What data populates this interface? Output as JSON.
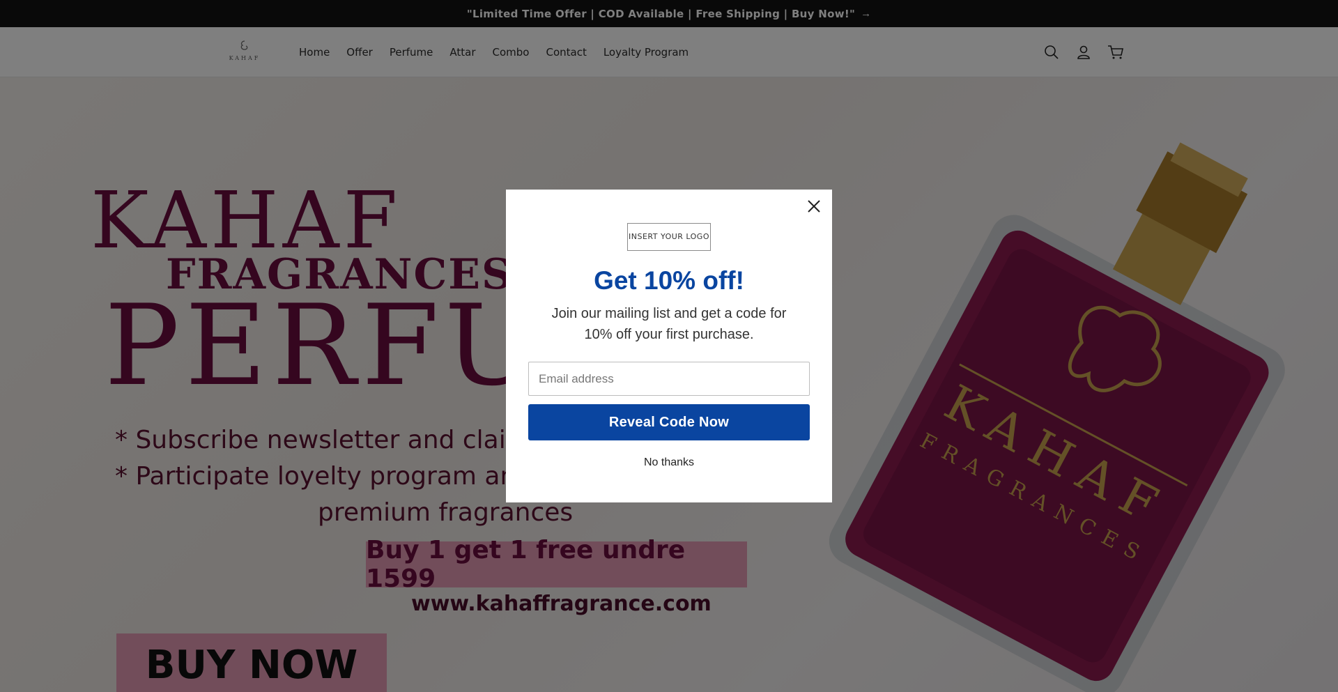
{
  "announcement": {
    "text": "\"Limited Time Offer | COD Available | Free Shipping | Buy Now!\"",
    "arrow": "→"
  },
  "header": {
    "logo_text": "KAHAF",
    "nav": [
      {
        "label": "Home"
      },
      {
        "label": "Offer"
      },
      {
        "label": "Perfume"
      },
      {
        "label": "Attar"
      },
      {
        "label": "Combo"
      },
      {
        "label": "Contact"
      },
      {
        "label": "Loyalty Program"
      }
    ],
    "icons": [
      "search-icon",
      "account-icon",
      "cart-icon"
    ]
  },
  "hero": {
    "line1": "KAHAF",
    "line2": "FRAGRANCES",
    "line3": "PERFU",
    "bullet1": "* Subscribe newsletter and claim",
    "bullet2": "* Participate loyelty  program an",
    "bullet3": "premium fragrances",
    "offer": "Buy 1 get 1 free undre 1599",
    "website": "www.kahaffragrance.com",
    "cta": "BUY NOW",
    "bottle_brand": "KAHAF",
    "bottle_sub": "FRAGRANCES",
    "colors": {
      "brand": "#6a0d3e",
      "highlight": "#e59ab4"
    }
  },
  "popup": {
    "logo_placeholder": "INSERT YOUR LOGO",
    "title": "Get 10% off!",
    "subtitle": "Join our mailing list and get a code for 10% off your first purchase.",
    "email_placeholder": "Email address",
    "cta": "Reveal Code Now",
    "dismiss": "No thanks",
    "accent": "#0a45a0"
  }
}
